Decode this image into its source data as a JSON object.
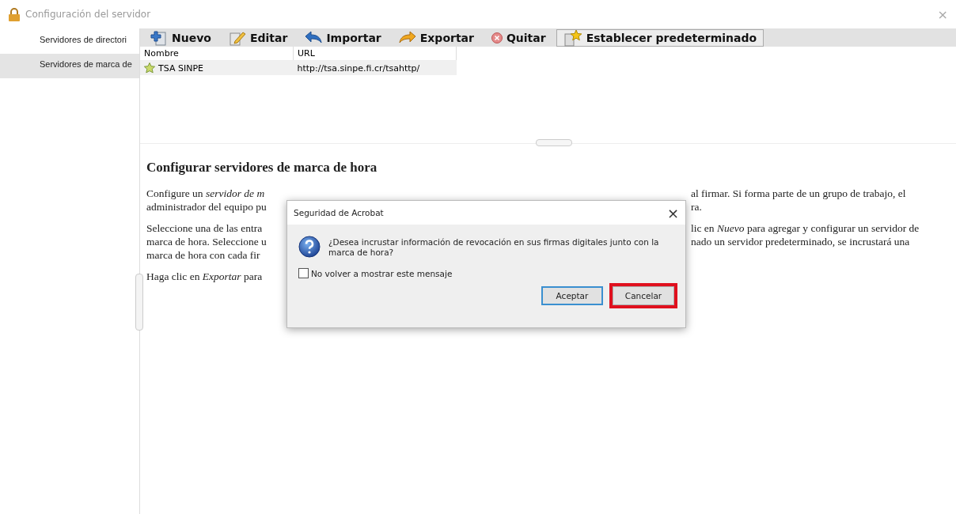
{
  "window": {
    "title": "Configuración del servidor",
    "close": "×"
  },
  "sidebar": {
    "items": [
      {
        "label": "Servidores de directori",
        "selected": false
      },
      {
        "label": "Servidores de marca de",
        "selected": true
      }
    ]
  },
  "toolbar": [
    {
      "label": "Nuevo",
      "kind": "new",
      "pressed": false
    },
    {
      "label": "Editar",
      "kind": "edit",
      "pressed": false
    },
    {
      "label": "Importar",
      "kind": "import",
      "pressed": false
    },
    {
      "label": "Exportar",
      "kind": "export",
      "pressed": false
    },
    {
      "label": "Quitar",
      "kind": "remove",
      "pressed": false
    },
    {
      "label": "Establecer predeterminado",
      "kind": "default",
      "pressed": true
    }
  ],
  "table": {
    "columns": [
      "Nombre",
      "URL"
    ],
    "rows": [
      {
        "name": "TSA SINPE",
        "url": "http://tsa.sinpe.fi.cr/tsahttp/",
        "selected": true
      }
    ]
  },
  "help": {
    "heading": "Configurar servidores de marca de hora",
    "paragraphs": [
      [
        {
          "left": "Configure un *servidor de m*",
          "right": "al firmar. Si forma parte de un grupo de trabajo, el"
        },
        {
          "left": "administrador del equipo pu",
          "right": "ra."
        }
      ],
      [
        {
          "left": "Seleccione una de las entra",
          "right": "lic en *Nuevo* para agregar y configurar un servidor de"
        },
        {
          "left": "marca de hora. Seleccione u",
          "right": "nado un servidor predeterminado, se incrustará una"
        },
        {
          "left": "marca de hora con cada fir"
        }
      ],
      [
        {
          "left": "Haga clic en *Exportar* para"
        }
      ]
    ]
  },
  "dialog": {
    "title": "Seguridad de Acrobat",
    "close": "×",
    "message": "¿Desea incrustar información de revocación en sus firmas digitales junto con la marca de hora?",
    "checkbox": {
      "label": "No volver a mostrar este mensaje",
      "checked": false
    },
    "buttons": [
      {
        "label": "Aceptar",
        "default": true,
        "highlighted": false
      },
      {
        "label": "Cancelar",
        "default": false,
        "highlighted": true
      }
    ]
  }
}
